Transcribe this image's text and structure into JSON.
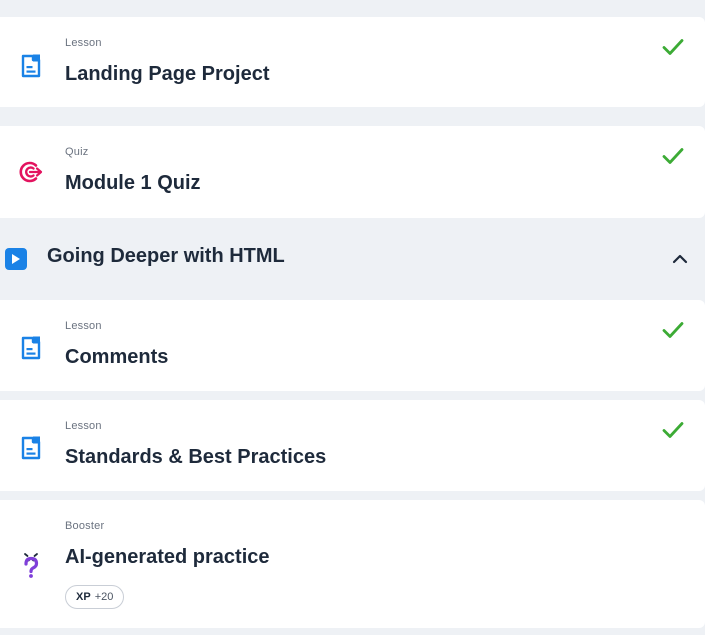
{
  "colors": {
    "background": "#eef1f5",
    "card": "#ffffff",
    "check": "#3cab35",
    "lesson_icon": "#1a82e6",
    "quiz_icon": "#e3135f",
    "booster_icon": "#7f3fd9",
    "section_icon": "#1a82e6"
  },
  "items_top": [
    {
      "type": "Lesson",
      "title": "Landing Page Project",
      "icon": "lesson-doc-icon",
      "completed": true
    },
    {
      "type": "Quiz",
      "title": "Module 1 Quiz",
      "icon": "quiz-target-icon",
      "completed": true
    }
  ],
  "section": {
    "title": "Going Deeper with HTML",
    "icon": "play-icon",
    "expanded": true,
    "toggle_icon": "chevron-up-icon"
  },
  "items_section": [
    {
      "type": "Lesson",
      "title": "Comments",
      "icon": "lesson-doc-icon",
      "completed": true
    },
    {
      "type": "Lesson",
      "title": "Standards & Best Practices",
      "icon": "lesson-doc-icon",
      "completed": true
    },
    {
      "type": "Booster",
      "title": "AI-generated practice",
      "icon": "question-mark-icon",
      "completed": false,
      "xp": {
        "label": "XP",
        "value": "+20"
      }
    }
  ]
}
